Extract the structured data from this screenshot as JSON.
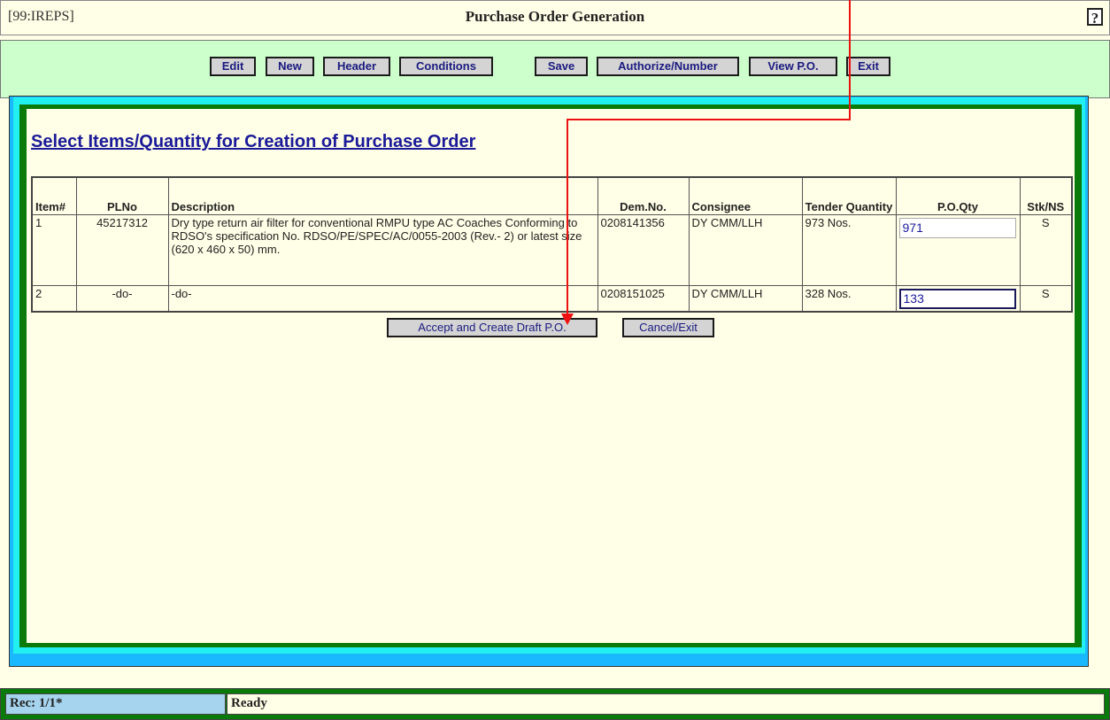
{
  "titlebar": {
    "app_code": "[99:IREPS]",
    "title": "Purchase Order Generation",
    "help_label": "?"
  },
  "toolbar": {
    "buttons": [
      "Edit",
      "New",
      "Header",
      "Conditions",
      "Save",
      "Authorize/Number",
      "View P.O.",
      "Exit"
    ]
  },
  "main": {
    "heading": "Select Items/Quantity for Creation of Purchase Order",
    "columns": [
      "Item#",
      "PLNo",
      "Description",
      "Dem.No.",
      "Consignee",
      "Tender Quantity",
      "P.O.Qty",
      "Stk/NS"
    ],
    "rows": [
      {
        "item": "1",
        "plno": "45217312",
        "description": "Dry type return air filter for conventional RMPU type AC Coaches Conforming to RDSO's specification No. RDSO/PE/SPEC/AC/0055-2003 (Rev.- 2) or latest size (620 x 460 x 50) mm.",
        "dem_no": "0208141356",
        "consignee": "DY CMM/LLH",
        "tender_qty": "973 Nos.",
        "po_qty": "971",
        "stk": "S"
      },
      {
        "item": "2",
        "plno": "-do-",
        "description": "-do-",
        "dem_no": "0208151025",
        "consignee": "DY CMM/LLH",
        "tender_qty": "328 Nos.",
        "po_qty": "133",
        "stk": "S"
      }
    ],
    "accept_label": "Accept and Create Draft P.O.",
    "cancel_label": "Cancel/Exit"
  },
  "status": {
    "record": "Rec: 1/1*",
    "message": "Ready"
  },
  "colors": {
    "toolbar_bg": "#ccffcc",
    "page_bg": "#fffee6",
    "heading": "#1a1a99",
    "annotation_arrow": "#ee1111"
  }
}
